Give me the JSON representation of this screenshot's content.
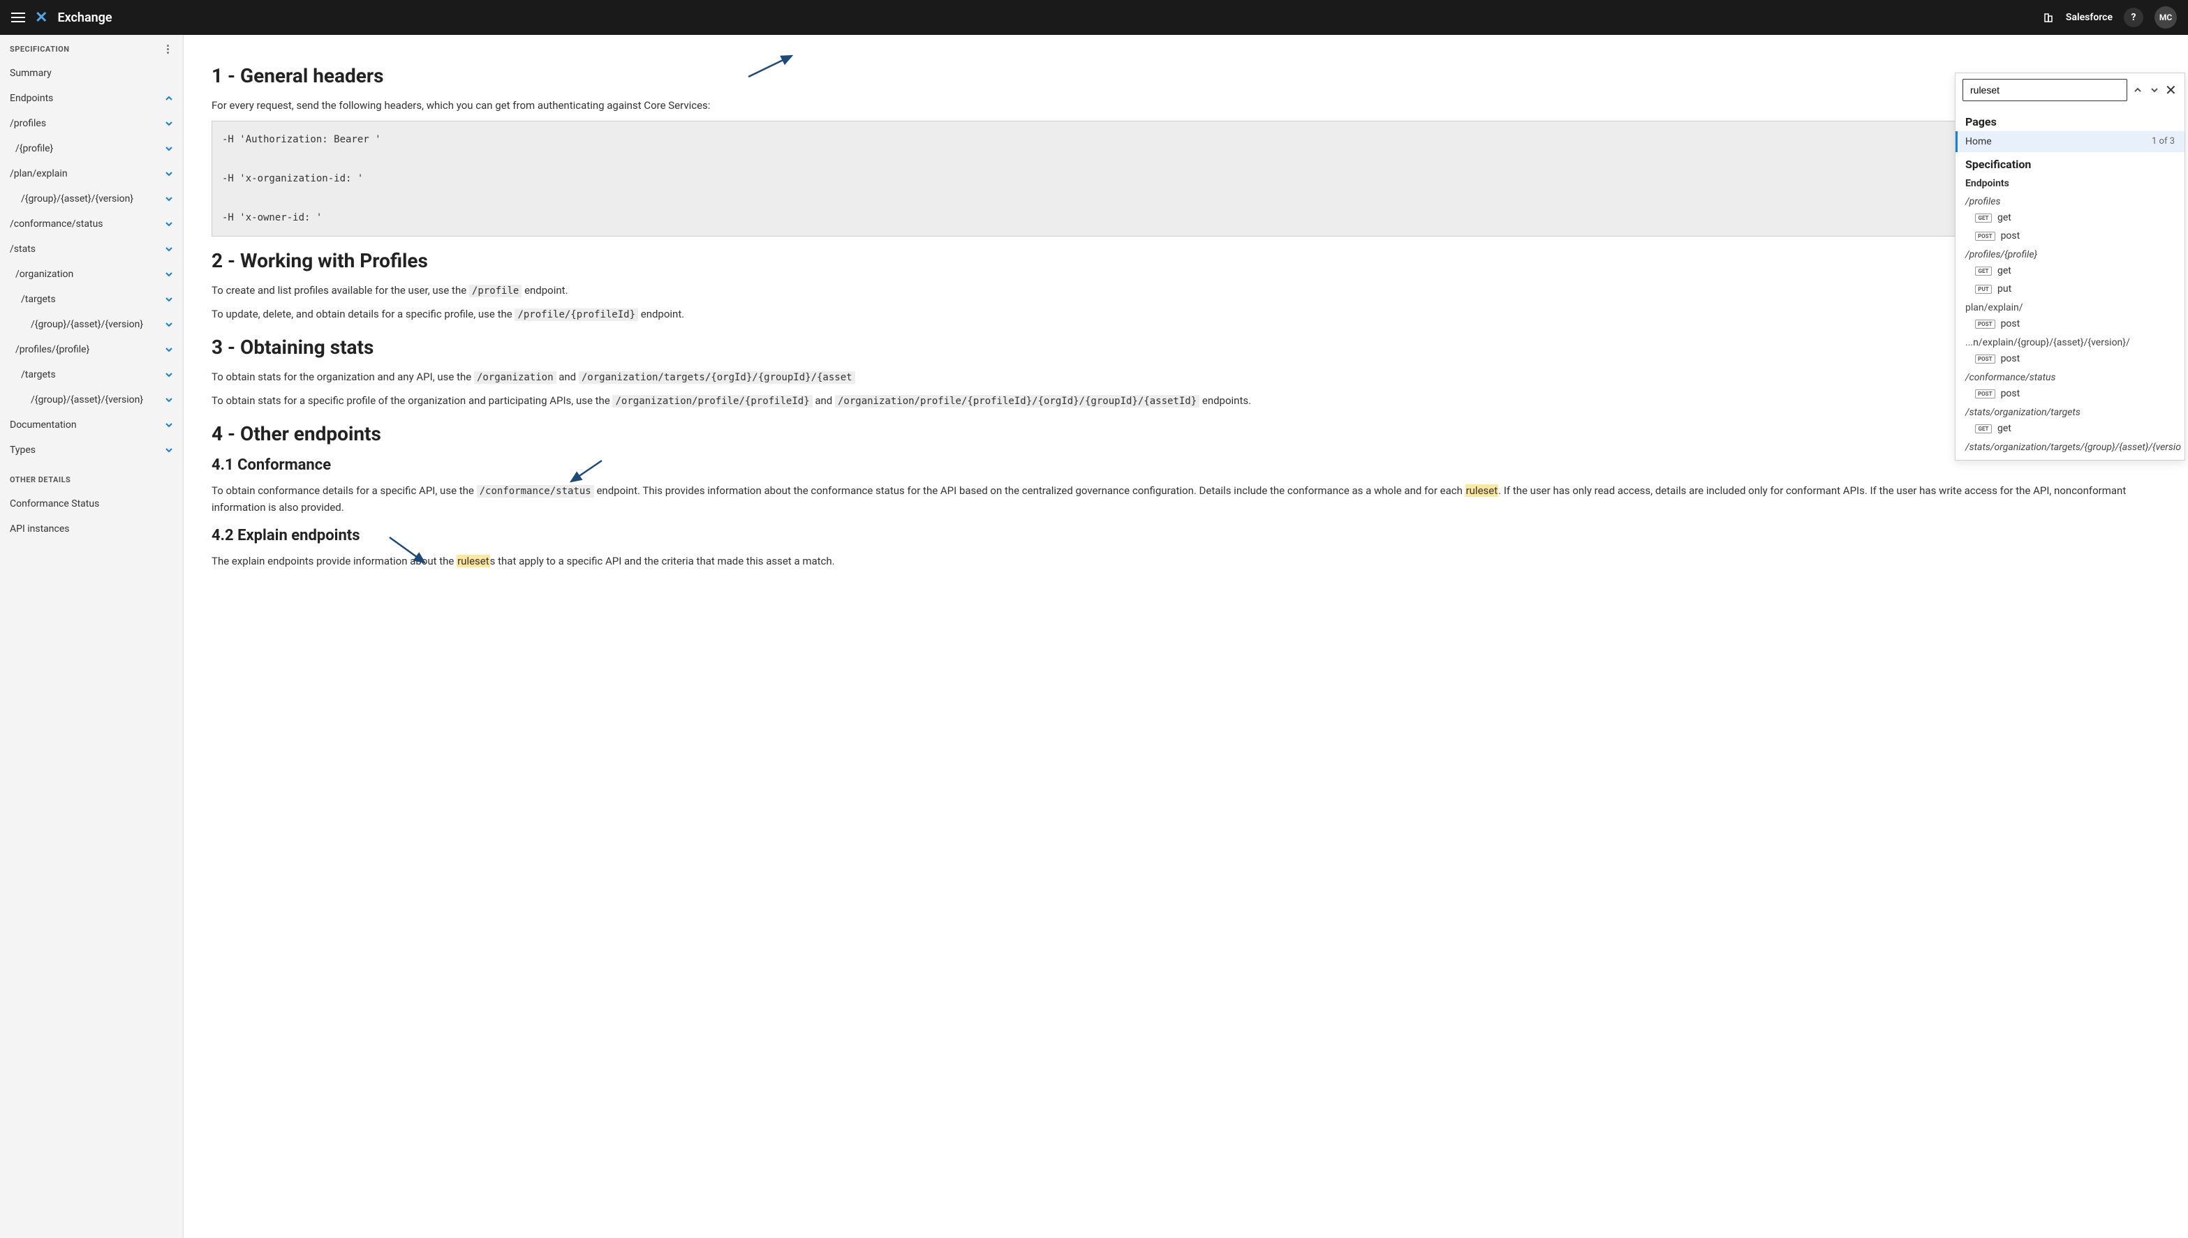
{
  "header": {
    "app_title": "Exchange",
    "org_name": "Salesforce",
    "help": "?",
    "avatar": "MC"
  },
  "sidebar": {
    "section_spec": "SPECIFICATION",
    "summary": "Summary",
    "endpoints": "Endpoints",
    "items": [
      {
        "label": "/profiles",
        "level": "a"
      },
      {
        "label": "/{profile}",
        "level": "b"
      },
      {
        "label": "/plan/explain",
        "level": "a"
      },
      {
        "label": "/{group}/{asset}/{version}",
        "level": "c"
      },
      {
        "label": "/conformance/status",
        "level": "a"
      },
      {
        "label": "/stats",
        "level": "a"
      },
      {
        "label": "/organization",
        "level": "b"
      },
      {
        "label": "/targets",
        "level": "c"
      },
      {
        "label": "/{group}/{asset}/{version}",
        "level": "d"
      },
      {
        "label": "/profiles/{profile}",
        "level": "b"
      },
      {
        "label": "/targets",
        "level": "c"
      },
      {
        "label": "/{group}/{asset}/{version}",
        "level": "d"
      }
    ],
    "documentation": "Documentation",
    "types": "Types",
    "section_other": "OTHER DETAILS",
    "conformance_status": "Conformance Status",
    "api_instances": "API instances"
  },
  "content": {
    "h1_1": "1 - General headers",
    "p1": "For every request, send the following headers, which you can get from authenticating against Core Services:",
    "code1": "-H 'Authorization: Bearer '\n\n-H 'x-organization-id: '\n\n-H 'x-owner-id: '",
    "h1_2": "2 - Working with Profiles",
    "p2a": "To create and list profiles available for the user, use the ",
    "p2a_code": "/profile",
    "p2a_end": " endpoint.",
    "p2b": "To update, delete, and obtain details for a specific profile, use the ",
    "p2b_code": "/profile/{profileId}",
    "p2b_end": " endpoint.",
    "h1_3": "3 - Obtaining stats",
    "p3a": "To obtain stats for the organization and any API, use the ",
    "p3a_c1": "/organization",
    "p3a_mid": " and ",
    "p3a_c2": "/organization/targets/{orgId}/{groupId}/{asset",
    "p3b": "To obtain stats for a specific profile of the organization and participating APIs, use the ",
    "p3b_c1": "/organization/profile/{profileId}",
    "p3b_mid": " and ",
    "p3b_c2": "/organization/profile/{profileId}/{orgId}/{groupId}/{assetId}",
    "p3b_end": " endpoints.",
    "h1_4": "4 - Other endpoints",
    "h2_41": "4.1 Conformance",
    "p41a": "To obtain conformance details for a specific API, use the ",
    "p41a_code": "/conformance/status",
    "p41a_mid": " endpoint. This provides information about the conformance status for the API based on the centralized governance configuration. Details include the conformance as a whole and for each ",
    "p41a_hl": "ruleset",
    "p41a_end": ". If the user has only read access, details are included only for conformant APIs. If the user has write access for the API, nonconformant information is also provided.",
    "h2_42": "4.2 Explain endpoints",
    "p42a": "The explain endpoints provide information about the ",
    "p42a_hl": "ruleset",
    "p42a_end": "s that apply to a specific API and the criteria that made this asset a match."
  },
  "search": {
    "value": "ruleset",
    "pages_title": "Pages",
    "home_label": "Home",
    "home_count": "1 of 3",
    "spec_title": "Specification",
    "endpoints_title": "Endpoints",
    "results": [
      {
        "path": "/profiles",
        "ital": true,
        "methods": [
          {
            "badge": "GET",
            "name": "get"
          },
          {
            "badge": "POST",
            "name": "post"
          }
        ]
      },
      {
        "path": "/profiles/{profile}",
        "ital": true,
        "methods": [
          {
            "badge": "GET",
            "name": "get"
          },
          {
            "badge": "PUT",
            "name": "put"
          }
        ]
      },
      {
        "path": "plan/explain/",
        "ital": false,
        "methods": [
          {
            "badge": "POST",
            "name": "post"
          }
        ]
      },
      {
        "path": "...n/explain/{group}/{asset}/{version}/",
        "ital": false,
        "methods": [
          {
            "badge": "POST",
            "name": "post"
          }
        ]
      },
      {
        "path": "/conformance/status",
        "ital": true,
        "methods": [
          {
            "badge": "POST",
            "name": "post"
          }
        ]
      },
      {
        "path": "/stats/organization/targets",
        "ital": true,
        "methods": [
          {
            "badge": "GET",
            "name": "get"
          }
        ]
      },
      {
        "path": "/stats/organization/targets/{group}/{asset}/{versio",
        "ital": true,
        "methods": []
      }
    ]
  }
}
